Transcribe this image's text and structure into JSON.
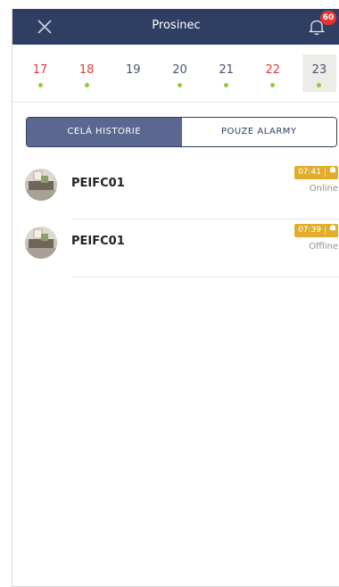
{
  "header": {
    "title": "Prosinec",
    "notification_count": "60"
  },
  "calendar": {
    "days": [
      {
        "label": "17",
        "color": "red",
        "dot": true
      },
      {
        "label": "18",
        "color": "red",
        "dot": true
      },
      {
        "label": "19",
        "color": "normal",
        "dot": false
      },
      {
        "label": "20",
        "color": "normal",
        "dot": true
      },
      {
        "label": "21",
        "color": "normal",
        "dot": true
      },
      {
        "label": "22",
        "color": "red",
        "dot": true
      },
      {
        "label": "23",
        "color": "normal",
        "dot": true,
        "selected": true
      }
    ]
  },
  "filter": {
    "all_label": "CELÁ HISTORIE",
    "alarms_label": "POUZE ALARMY",
    "active": "all"
  },
  "events": [
    {
      "device": "PEIFC01",
      "time": "07:41",
      "status": "Online"
    },
    {
      "device": "PEIFC01",
      "time": "07:39",
      "status": "Offline"
    }
  ],
  "colors": {
    "header": "#2f3e63",
    "accent_red": "#e23b3b",
    "dot_green": "#8ccd3b",
    "badge_gold": "#e0ae2c"
  }
}
